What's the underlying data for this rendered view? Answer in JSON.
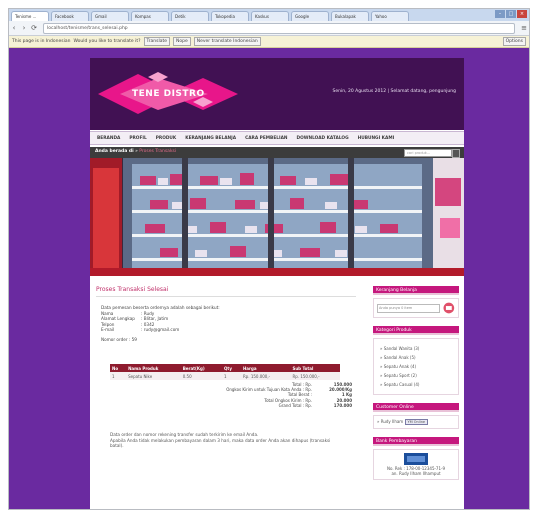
{
  "browser": {
    "tabs": [
      "Tenisme ...",
      "Facebook",
      "Gmail",
      "Kompas",
      "Detik",
      "Tokopedia",
      "Kaskus",
      "Google",
      "Bukalapak",
      "Yahoo"
    ],
    "active_tab": 0,
    "url": "localhost/tenisme/trans_selesai.php",
    "translate_bar": {
      "message": "This page is in Indonesian",
      "question": "Would you like to translate it?",
      "translate_label": "Translate",
      "nope_label": "Nope",
      "never_label": "Never translate Indonesian",
      "options_label": "Options"
    }
  },
  "site": {
    "logo_text": "TENE DISTRO",
    "header_info": "Senin, 20 Agustus 2012 | Selamat datang, pengunjung",
    "menu": [
      "BERANDA",
      "PROFIL",
      "PRODUK",
      "KERANJANG BELANJA",
      "CARA PEMBELIAN",
      "DOWNLOAD KATALOG",
      "HUBUNGI KAMI"
    ],
    "breadcrumb": {
      "home": "Anda berada di",
      "current": "Proses Transaksi"
    },
    "search_placeholder": "cari produk..."
  },
  "main": {
    "title": "Proses Transaksi Selesai",
    "receiver_intro": "Data pemesan beserta ordernya adalah sebagai berikut:",
    "receiver": [
      {
        "k": "Nama",
        "v": ": Rudy"
      },
      {
        "k": "Alamat Lengkap",
        "v": ": Blitar, Jatim"
      },
      {
        "k": "Telpon",
        "v": ": 0342"
      },
      {
        "k": "E-mail",
        "v": ": rudy@gmail.com"
      }
    ],
    "order_label": "Nomor order : 59",
    "table": {
      "headers": [
        "No",
        "Nama Produk",
        "Berat(Kg)",
        "Qty",
        "Harga",
        "Sub Total"
      ],
      "rows": [
        [
          "1",
          "Sepatu Nike",
          "0.50",
          "1",
          "Rp. 150.000,-",
          "Rp. 150.000,-"
        ]
      ]
    },
    "totals": [
      {
        "label": "Total : Rp.",
        "value": "150.000"
      },
      {
        "label": "Ongkos Kirim untuk Tujuan Kota Anda : Rp.",
        "value": "20.000/Kg"
      },
      {
        "label": "Total Berat :",
        "value": "1 Kg"
      },
      {
        "label": "Total Ongkos Kirim : Rp.",
        "value": "20.000"
      },
      {
        "label": "Grand Total : Rp.",
        "value": "170.000"
      }
    ],
    "note1": "Data order dan nomor rekening transfer sudah terkirim ke email Anda.",
    "note2": "Apabila Anda tidak melakukan pembayaran dalam 3 hari, maka data order Anda akan dihapus (transaksi batal)."
  },
  "sidebar": {
    "cart_title": "Keranjang Belanja",
    "cart_input": "Anda punya 0 item",
    "categories_title": "Kategori Produk",
    "categories": [
      "Sandal Wanita (3)",
      "Sandal Anak (5)",
      "Sepatu Anak (4)",
      "Sepatu Sport (2)",
      "Sepatu Casual (4)"
    ],
    "support_title": "Customer Online",
    "support_item": "Rudy Ilham",
    "support_btn": "YM Online",
    "payment_title": "Bank Pembayaran",
    "payment_text1": "No. Rek : 178-00-12345-71-9",
    "payment_text2": "an. Rudy Ilham Ilhamput"
  },
  "colors": {
    "background": "#6a2aa0",
    "header": "#411153",
    "accent": "#c5177d",
    "table_header": "#8e1b2e"
  }
}
